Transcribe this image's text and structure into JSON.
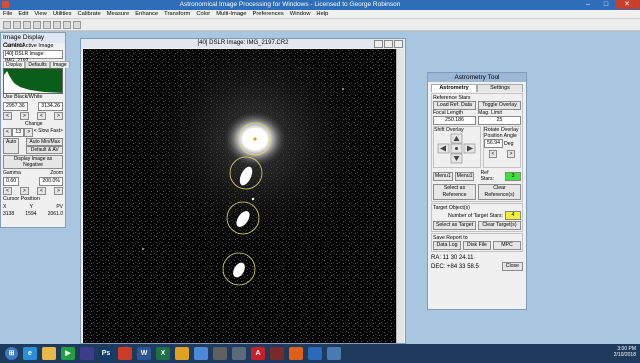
{
  "app": {
    "title": "Astronomical Image Processing for Windows - Licensed to George Robinson",
    "menu": [
      "File",
      "Edit",
      "View",
      "Utilities",
      "Calibrate",
      "Measure",
      "Enhance",
      "Transform",
      "Color",
      "Multi-Image",
      "Preferences",
      "Window",
      "Help"
    ]
  },
  "display_control": {
    "title": "Image Display Control",
    "current_label": "Current Active Image",
    "current_value": "[40] DSLR Image: IMG_2197",
    "tabs": [
      "Display",
      "Defaults",
      "Image"
    ],
    "levels_label": "Use Black/White",
    "black": "2957.36",
    "white": "3134.26",
    "change_label": "Change",
    "step": "13",
    "slow_fast": "< Slow Fast>",
    "auto": "Auto",
    "auto_minmax": "Auto Min/Max",
    "default_av": "Default & AV",
    "display_negative": "Display Image as Negative",
    "gamma_label": "Gamma",
    "gamma": "0.60",
    "zoom_label": "Zoom",
    "zoom": "200.0%",
    "cursor_label": "Cursor Position",
    "col_x": "X",
    "col_y": "Y",
    "col_pv": "PV",
    "x": "3138",
    "y": "1594",
    "pv": "2061.0"
  },
  "image_window": {
    "title": "[40] DSLR Image: IMG_2197.CR2"
  },
  "astrometry": {
    "title": "Astrometry Tool",
    "tabs": [
      "Astrometry",
      "Settings"
    ],
    "ref_stars_label": "Reference Stars",
    "load_ref_data": "Load Ref. Data",
    "toggle_overlay": "Toggle Overlay",
    "focal_length_label": "Focal Length",
    "focal_length": "250.186",
    "mag_limit_label": "Mag. Limit",
    "mag_limit": "25",
    "shift_overlay": "Shift Overlay",
    "rotate_overlay": "Rotate Overlay",
    "position_angle_label": "Position Angle",
    "position_angle": "56.94",
    "deg": "Deg",
    "menu1": "Menu1",
    "menu2": "Menu1",
    "ref_stars_count_label": "Ref Stars:",
    "ref_stars_count": "3",
    "select_as_reference": "Select as Reference",
    "clear_references": "Clear Reference(s)",
    "target_label": "Target Object(s)",
    "num_targets_label": "Number of Target Stars:",
    "num_targets": "4",
    "select_as_target": "Select as Target",
    "clear_targets": "Clear Target(s)",
    "save_report": "Save Report to",
    "data_log": "Data Log",
    "disk_file": "Disk File",
    "mpc": "MPC",
    "ra": "RA:  11 30 24.11",
    "dec": "DEC: +84 33 58.5",
    "close": "Close"
  },
  "taskbar": {
    "time": "3:00 PM",
    "date": "2/10/2018"
  },
  "colors": {
    "accent": "#2e6db8",
    "ref_stars_count_bg": "#3ee03e",
    "targets_bg": "#f5ef3a"
  }
}
